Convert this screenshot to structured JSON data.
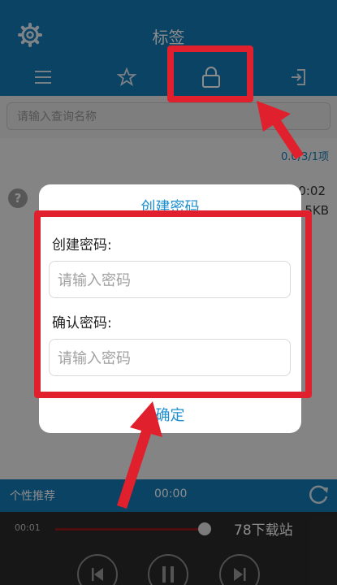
{
  "app": {
    "title": "标签",
    "tabs": [
      {
        "icon": "menu-icon"
      },
      {
        "icon": "star-icon"
      },
      {
        "icon": "lock-icon"
      },
      {
        "icon": "exit-icon"
      }
    ]
  },
  "search": {
    "placeholder": "请输入查询名称"
  },
  "list": {
    "count": "0.0/3/1项",
    "item": {
      "icon": "?",
      "time": "0:02",
      "size": "5KB"
    }
  },
  "dialog": {
    "title": "创建密码",
    "create_label": "创建密码:",
    "create_placeholder": "请输入密码",
    "confirm_label": "确认密码:",
    "confirm_placeholder": "请输入密码",
    "confirm_button": "确定"
  },
  "player": {
    "rec_label": "个性推荐",
    "time": "00:00",
    "current": "00:01",
    "progress": 0.85,
    "watermark": "78下载站"
  },
  "colors": {
    "header": "#157ab8",
    "accent": "#1c8fd0",
    "annotation": "#e0202c"
  }
}
